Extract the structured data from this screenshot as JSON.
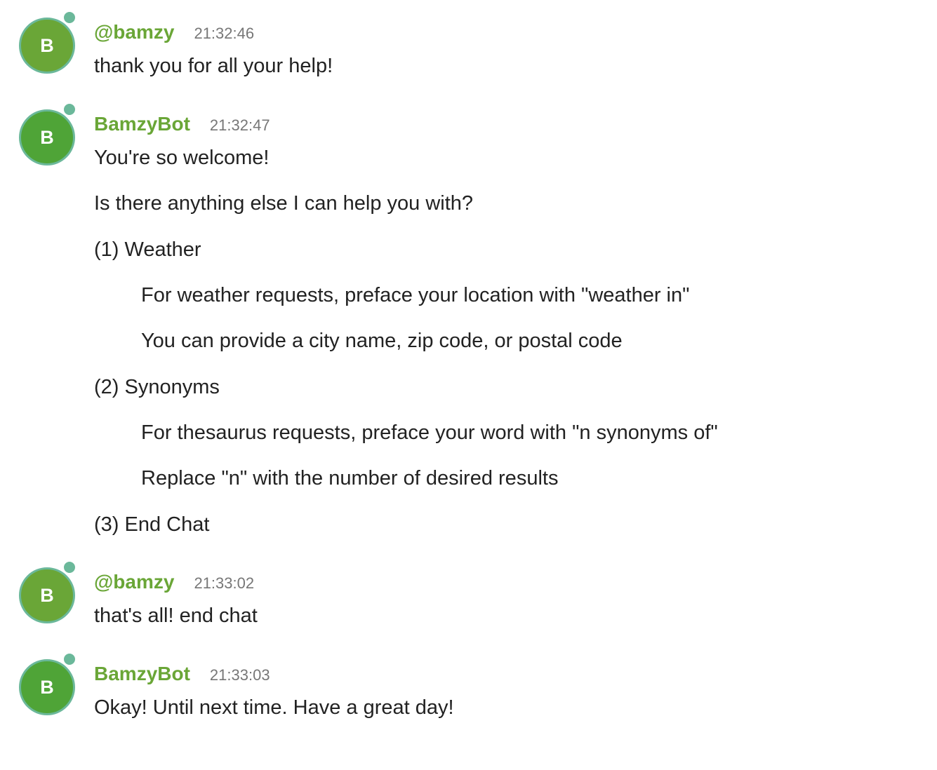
{
  "messages": [
    {
      "avatar_letter": "B",
      "sender": "@bamzy",
      "time": "21:32:46",
      "lines": [
        "thank you for all your help!"
      ]
    },
    {
      "avatar_letter": "B",
      "sender": "BamzyBot",
      "time": "21:32:47",
      "lines": [
        "You're so welcome!",
        "Is there anything else I can help you with?",
        "(1) Weather",
        "For weather requests, preface your location with \"weather in\"",
        "You can provide a city name, zip code, or postal code",
        "(2) Synonyms",
        "For thesaurus requests, preface your word with \"n synonyms of\"",
        "Replace \"n\" with the number of desired results",
        "(3) End Chat"
      ]
    },
    {
      "avatar_letter": "B",
      "sender": "@bamzy",
      "time": "21:33:02",
      "lines": [
        "that's all! end chat"
      ]
    },
    {
      "avatar_letter": "B",
      "sender": "BamzyBot",
      "time": "21:33:03",
      "lines": [
        "Okay! Until next time. Have a great day!"
      ]
    }
  ],
  "colors": {
    "sender_name": "#6aa637",
    "user_avatar": "#6aa637",
    "bot_avatar": "#4fa437",
    "presence_dot": "#6bb89a",
    "timestamp": "#777777",
    "text": "#222222"
  }
}
